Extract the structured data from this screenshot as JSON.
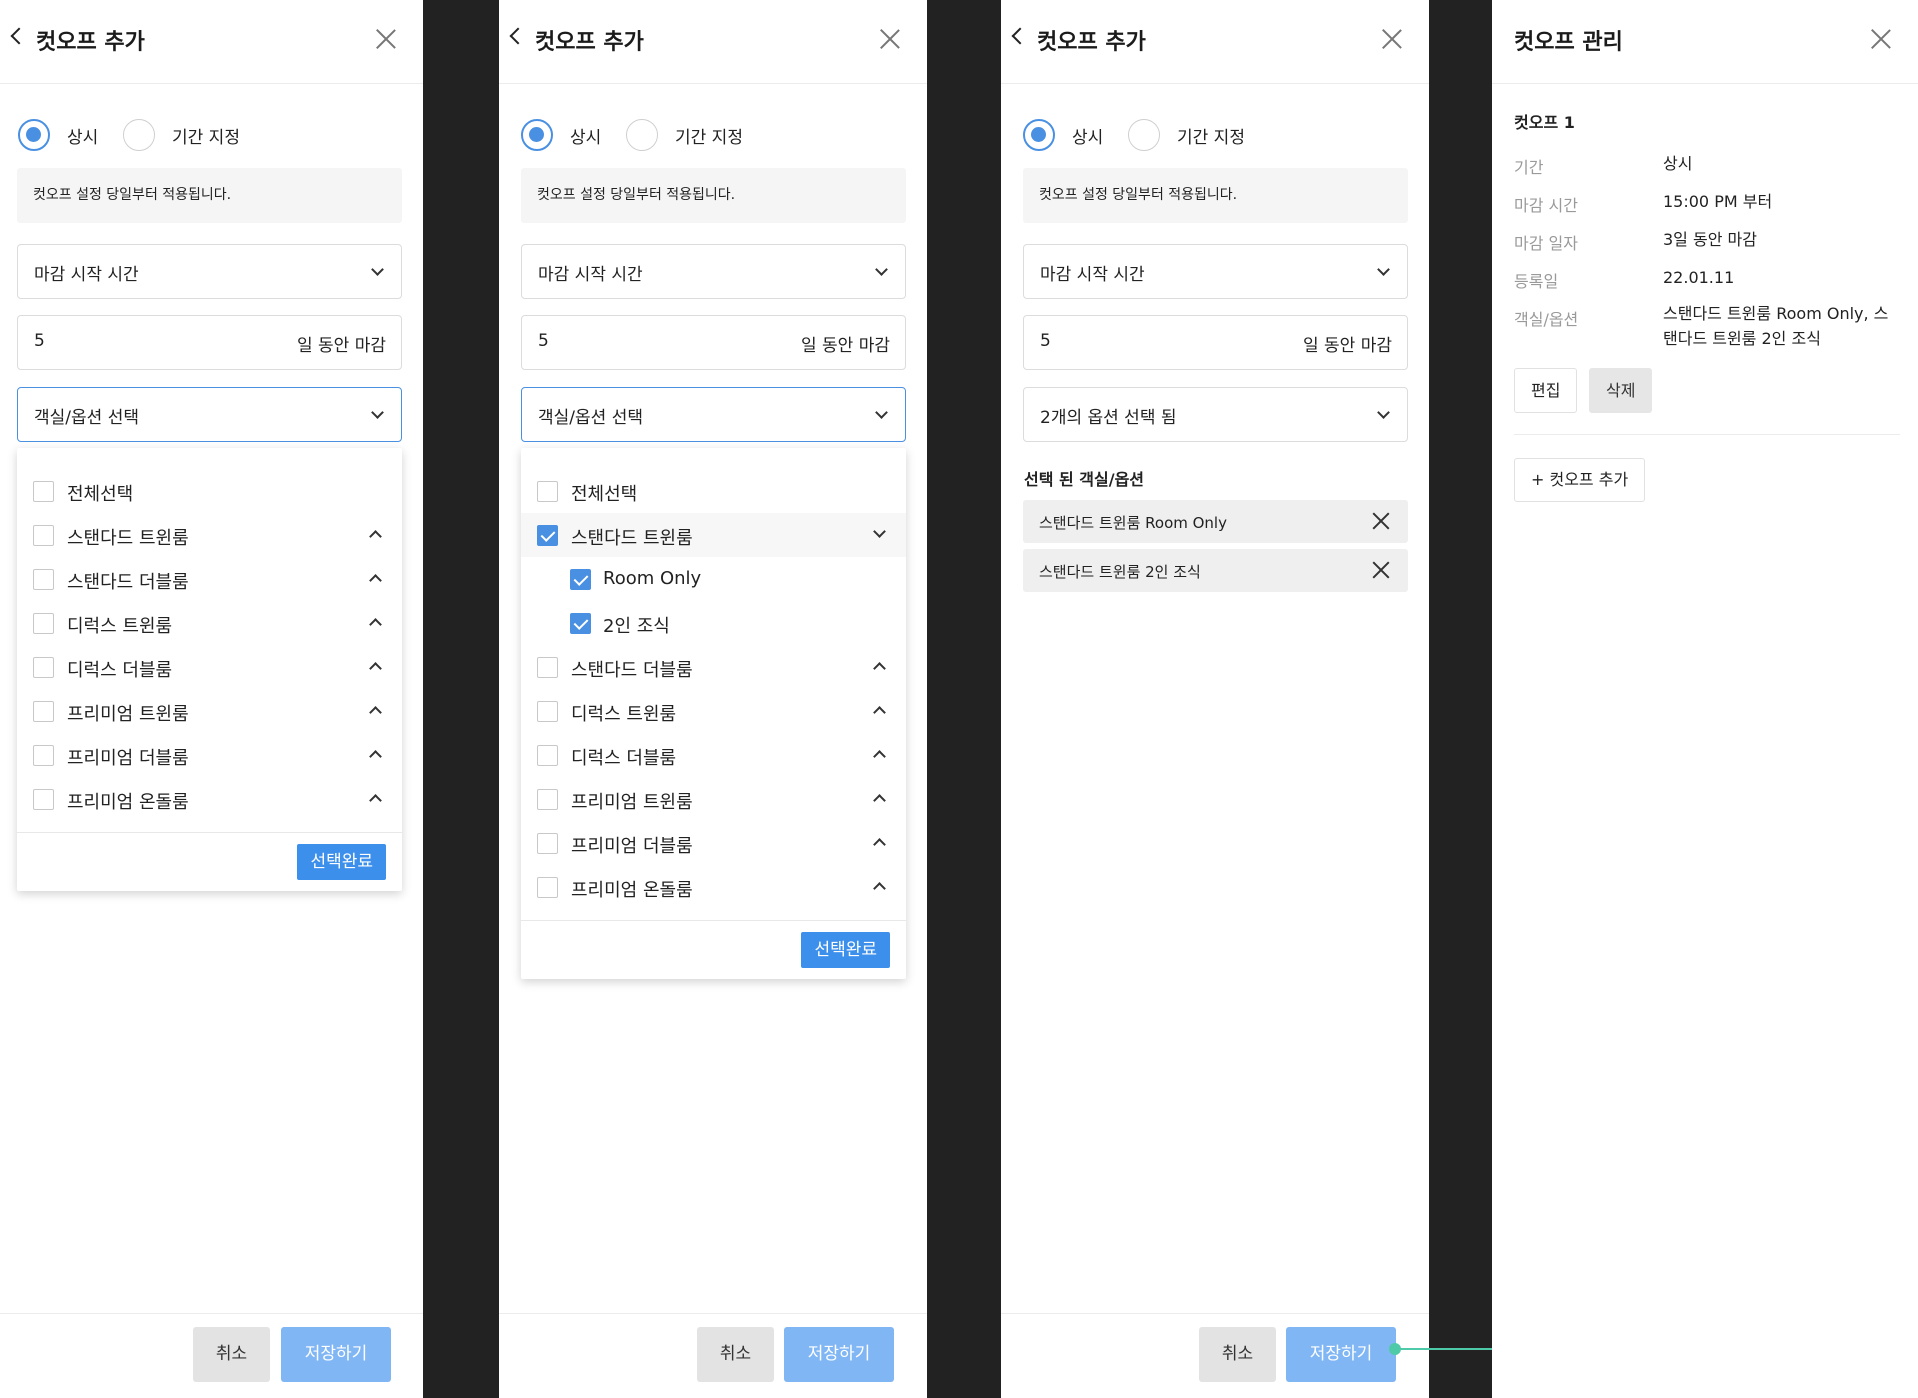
{
  "colors": {
    "accent": "#4a90e2",
    "primary_button": "#3d8fec",
    "save_button": "#80b6f4",
    "connector": "#4fcaa8"
  },
  "icons": {
    "back": "chevron-left-icon",
    "close": "close-icon",
    "dropdown": "chevron-down-icon",
    "expand": "chevron-up-icon",
    "remove": "x-icon"
  },
  "panel1": {
    "title": "컷오프 추가",
    "radio_permanent": "상시",
    "radio_period": "기간 지정",
    "notice": "컷오프 설정 당일부터 적용됩니다.",
    "start_time_placeholder": "마감 시작 시간",
    "days_value": "5",
    "days_suffix": "일 동안 마감",
    "room_select": "객실/옵션 선택",
    "dropdown_items": [
      "전체선택",
      "스탠다드 트윈룸",
      "스탠다드 더블룸",
      "디럭스 트윈룸",
      "디럭스 더블룸",
      "프리미엄 트윈룸",
      "프리미엄 더블룸",
      "프리미엄 온돌룸"
    ],
    "done_button": "선택완료",
    "cancel_button": "취소",
    "save_button": "저장하기"
  },
  "panel2": {
    "title": "컷오프 추가",
    "radio_permanent": "상시",
    "radio_period": "기간 지정",
    "notice": "컷오프 설정 당일부터 적용됩니다.",
    "start_time_placeholder": "마감 시작 시간",
    "days_value": "5",
    "days_suffix": "일 동안 마감",
    "room_select": "객실/옵션 선택",
    "dropdown_items": [
      "전체선택",
      "스탠다드 트윈룸",
      "Room Only",
      "2인 조식",
      "스탠다드 더블룸",
      "디럭스 트윈룸",
      "디럭스 더블룸",
      "프리미엄 트윈룸",
      "프리미엄 더블룸",
      "프리미엄 온돌룸"
    ],
    "done_button": "선택완료",
    "cancel_button": "취소",
    "save_button": "저장하기"
  },
  "panel3": {
    "title": "컷오프 추가",
    "radio_permanent": "상시",
    "radio_period": "기간 지정",
    "notice": "컷오프 설정 당일부터 적용됩니다.",
    "start_time_placeholder": "마감 시작 시간",
    "days_value": "5",
    "days_suffix": "일 동안 마감",
    "room_select": "2개의 옵션 선택 됨",
    "selected_title": "선택 된 객실/옵션",
    "selected_items": [
      "스탠다드 트윈룸 Room Only",
      "스탠다드 트윈룸 2인 조식"
    ],
    "cancel_button": "취소",
    "save_button": "저장하기"
  },
  "panel4": {
    "title": "컷오프 관리",
    "cutoff_name": "컷오프 1",
    "rows": [
      {
        "key": "기간",
        "value": "상시"
      },
      {
        "key": "마감 시간",
        "value": "15:00 PM 부터"
      },
      {
        "key": "마감 일자",
        "value": "3일 동안 마감"
      },
      {
        "key": "등록일",
        "value": "22.01.11"
      },
      {
        "key": "객실/옵션",
        "value": "스탠다드 트윈룸 Room Only, 스탠다드 트윈룸 2인 조식"
      }
    ],
    "edit_button": "편집",
    "delete_button": "삭제",
    "add_button": "+ 컷오프 추가"
  }
}
